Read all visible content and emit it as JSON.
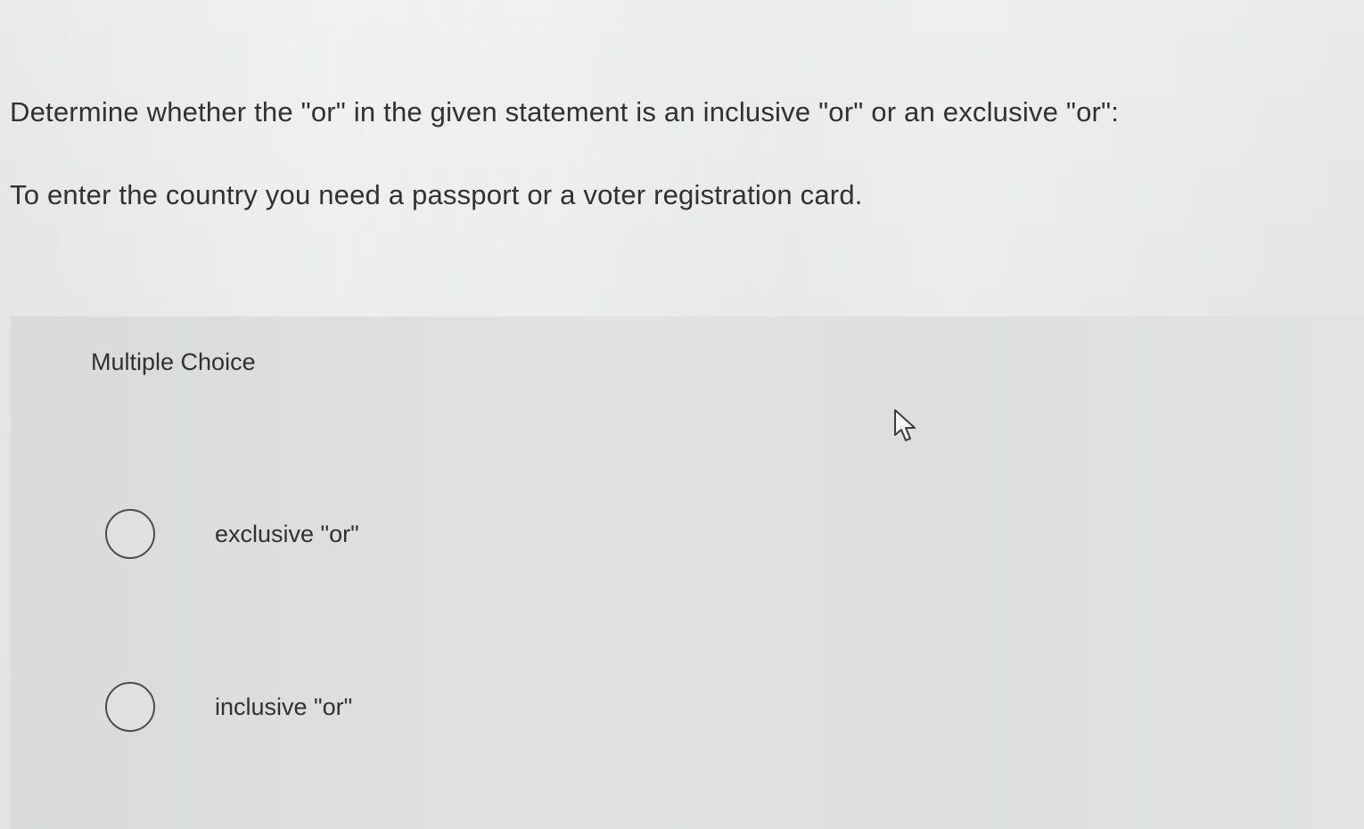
{
  "question": {
    "prompt": "Determine whether the \"or\" in the given statement is an inclusive \"or\" or an exclusive \"or\":",
    "statement": "To enter the country you need a passport or a voter registration card."
  },
  "choices": {
    "heading": "Multiple Choice",
    "options": [
      {
        "label": "exclusive \"or\"",
        "selected": false
      },
      {
        "label": "inclusive \"or\"",
        "selected": false
      }
    ]
  },
  "icons": {
    "cursor": "mouse-pointer-icon",
    "radio": "radio-unchecked-icon"
  },
  "colors": {
    "text": "#2f3133",
    "panel": "#d9dada",
    "background": "#e6e7e7"
  }
}
